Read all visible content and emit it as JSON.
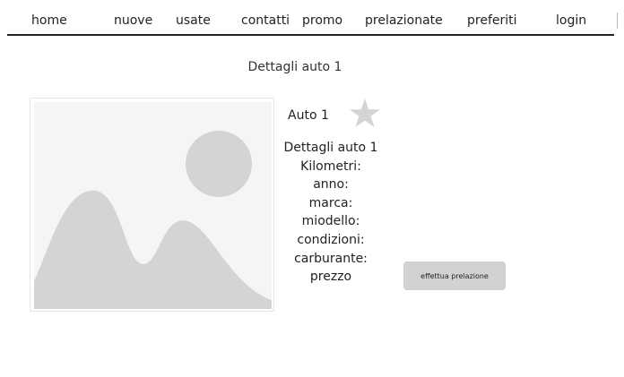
{
  "nav": {
    "items": [
      {
        "label": "home"
      },
      {
        "label": "nuove"
      },
      {
        "label": "usate"
      },
      {
        "label": "contatti"
      },
      {
        "label": "promo"
      },
      {
        "label": "prelazionate"
      },
      {
        "label": "preferiti"
      },
      {
        "label": "login"
      }
    ]
  },
  "page": {
    "title": "Dettagli auto 1"
  },
  "car": {
    "name": "Auto 1",
    "favorite_icon": "star-icon",
    "image_icon": "image-placeholder-icon",
    "details": {
      "heading": "Dettagli auto 1",
      "kilometri": "Kilometri:",
      "anno": "anno:",
      "marca": "marca:",
      "modello": "miodello:",
      "condizioni": "condizioni:",
      "carburante": "carburante:",
      "prezzo": "prezzo"
    },
    "reserve_label": "effettua prelazione"
  },
  "colors": {
    "placeholder": "#d4d4d4",
    "placeholder_bg": "#f5f5f5",
    "button": "#d2d2d2",
    "nav_border": "#222222"
  }
}
